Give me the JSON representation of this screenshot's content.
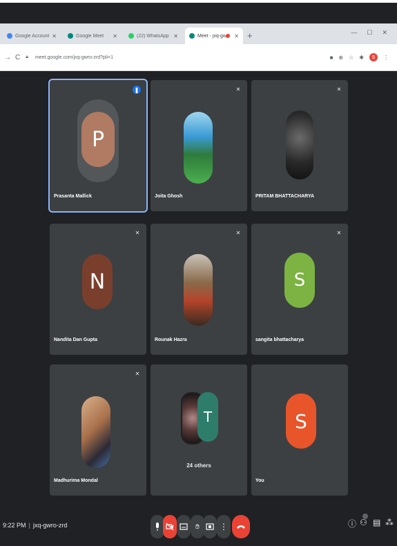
{
  "browser": {
    "tabs": [
      {
        "label": "Google Account",
        "favicon_color": "#4285f4"
      },
      {
        "label": "Google Meet",
        "favicon_color": "#00897b"
      },
      {
        "label": "(22) WhatsApp",
        "favicon_color": "#25d366"
      },
      {
        "label": "Meet - jxq-gwro-zrd",
        "favicon_color": "#00897b",
        "active": true
      }
    ],
    "new_tab": "+",
    "url": "meet.google.com/jxq-gwro-zrd?pli=1",
    "profile_initial": "S"
  },
  "participants": [
    {
      "name": "Prasanta Mallick",
      "initial": "P",
      "avatar_color": "#b07a63",
      "speaking": true
    },
    {
      "name": "Joita Ghosh",
      "photo": "landscape"
    },
    {
      "name": "PRITAM BHATTACHARYA",
      "photo": "dark"
    },
    {
      "name": "Nandita Dan Gupta",
      "initial": "N",
      "avatar_color": "#7a3f2c"
    },
    {
      "name": "Rounak Hazra",
      "photo": "group"
    },
    {
      "name": "sangita bhattacharya",
      "initial": "S",
      "avatar_color": "#7cb342"
    },
    {
      "name": "Madhurima Mondal",
      "photo": "person"
    },
    {
      "others_label": "24 others",
      "initial": "T",
      "avatar_color": "#2e7d6b"
    },
    {
      "name": "You",
      "initial": "S",
      "avatar_color": "#e8552a"
    }
  ],
  "meeting": {
    "time": "9:22 PM",
    "code": "jxq-gwro-zrd"
  },
  "colors": {
    "background": "#202124",
    "tile": "#3c4043",
    "speaking_outline": "#8ab4f8",
    "end_call": "#ea4335"
  }
}
